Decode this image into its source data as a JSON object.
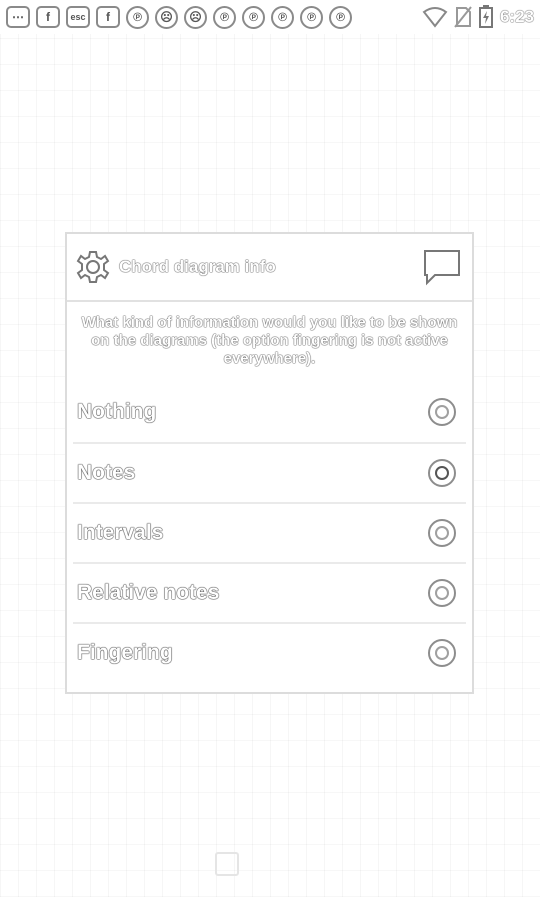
{
  "statusbar": {
    "left_icons": [
      {
        "name": "more-notification-icon",
        "glyph": "⋯"
      },
      {
        "name": "facebook-icon",
        "glyph": "f"
      },
      {
        "name": "esc-icon",
        "glyph": "esc"
      },
      {
        "name": "facebook-icon",
        "glyph": "f"
      },
      {
        "name": "pinterest-icon",
        "glyph": "℗"
      },
      {
        "name": "cat-app-icon",
        "glyph": "☹"
      },
      {
        "name": "cat-app-icon",
        "glyph": "☹"
      },
      {
        "name": "pinterest-icon",
        "glyph": "℗"
      },
      {
        "name": "pinterest-icon",
        "glyph": "℗"
      },
      {
        "name": "pinterest-icon",
        "glyph": "℗"
      },
      {
        "name": "pinterest-icon",
        "glyph": "℗"
      },
      {
        "name": "pinterest-icon",
        "glyph": "℗"
      }
    ],
    "time": "6:23"
  },
  "dialog": {
    "title": "Chord diagram info",
    "message": "What kind of information would you like to be shown on the diagrams (the option fingering is not active everywhere).",
    "options": [
      {
        "label": "Nothing",
        "selected": false
      },
      {
        "label": "Notes",
        "selected": true
      },
      {
        "label": "Intervals",
        "selected": false
      },
      {
        "label": "Relative notes",
        "selected": false
      },
      {
        "label": "Fingering",
        "selected": false
      }
    ]
  }
}
